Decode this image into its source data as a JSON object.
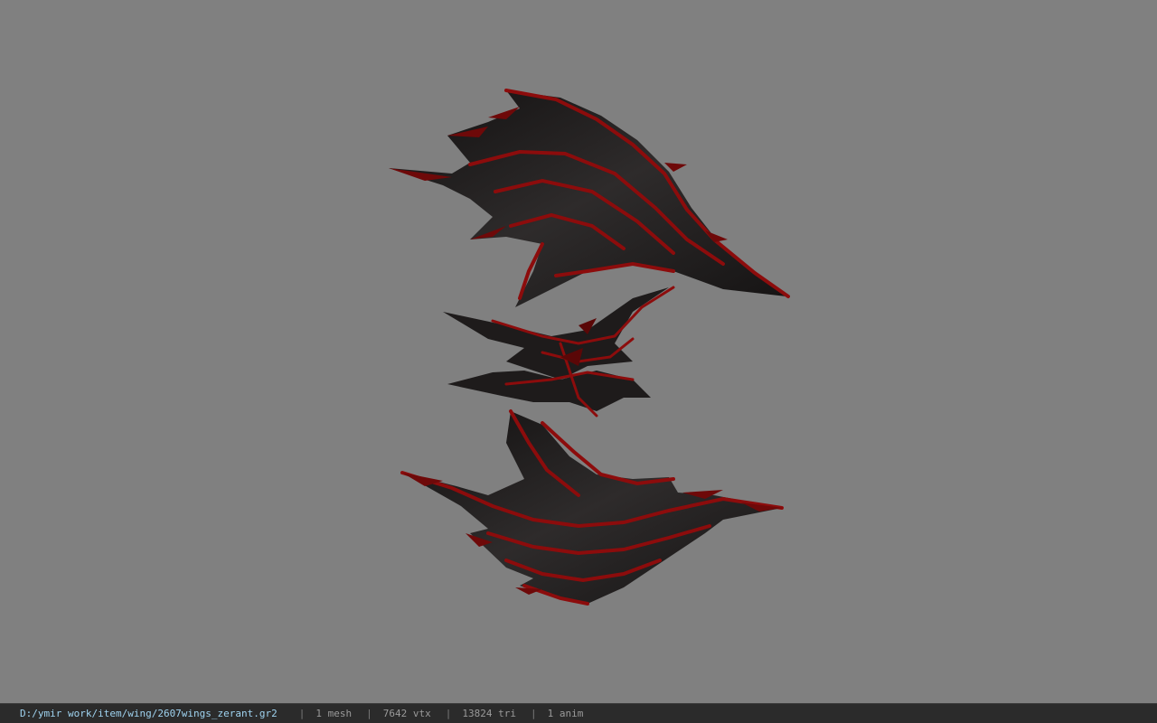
{
  "viewport": {
    "background": "#808080",
    "model": {
      "subject": "wings",
      "colors": {
        "membrane": "#1c1a1a",
        "membrane_light": "#2e2b2b",
        "trim": "#7a0a0a",
        "trim_bright": "#b01010"
      }
    }
  },
  "statusbar": {
    "file_path": "D:/ymir work/item/wing/2607wings_zerant.gr2",
    "separator": "|",
    "mesh": "1 mesh",
    "vertices": "7642 vtx",
    "triangles": "13824 tri",
    "animations": "1 anim",
    "path_color": "#9fd3f0"
  }
}
